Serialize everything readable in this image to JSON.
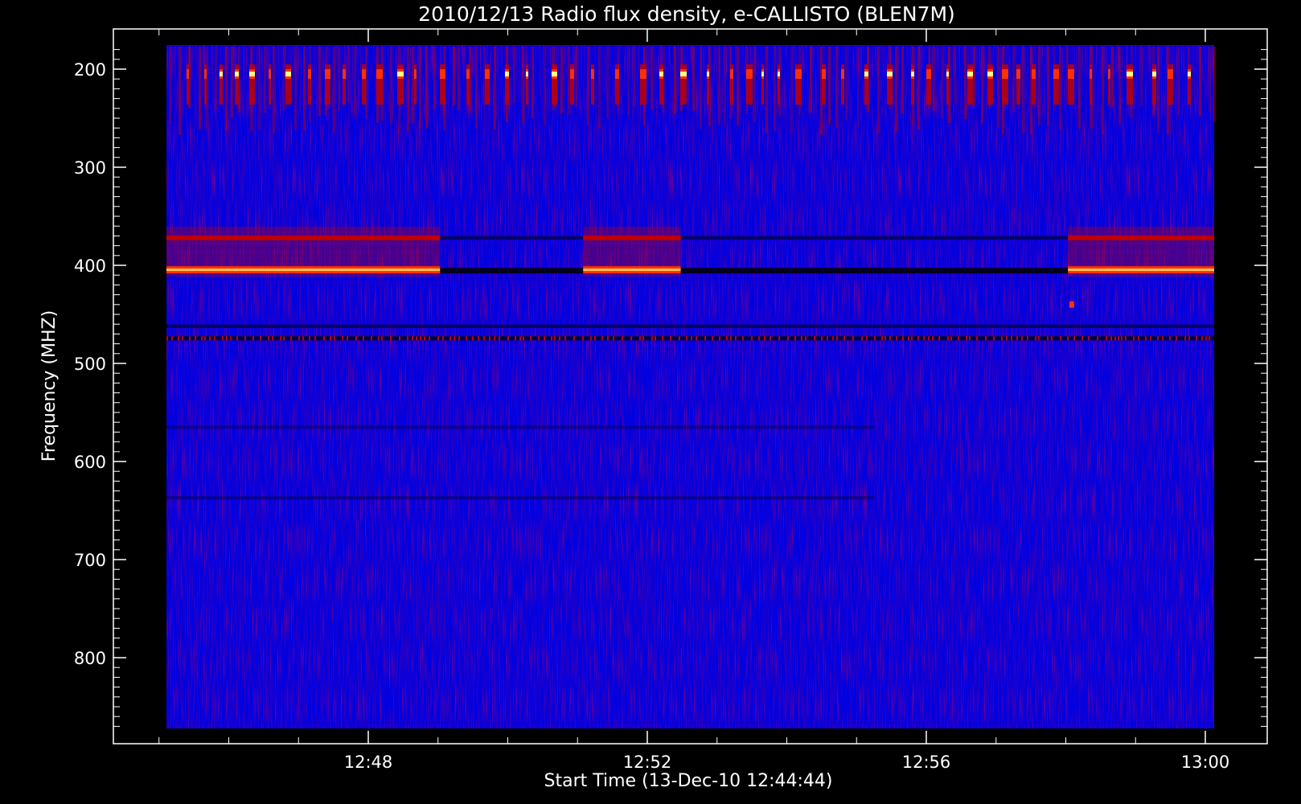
{
  "chart_data": {
    "type": "heatmap",
    "title": "2010/12/13  Radio flux density, e-CALLISTO (BLEN7M)",
    "xlabel": "Start Time (13-Dec-10 12:44:44)",
    "ylabel": "Frequency (MHZ)",
    "x_axis": {
      "unit": "time",
      "range": [
        "12:44:44",
        "13:00:10"
      ],
      "tick_labels": [
        "12:48",
        "12:52",
        "12:56",
        "13:00"
      ],
      "tick_values_min": [
        3.27,
        7.27,
        11.27,
        15.27
      ]
    },
    "y_axis": {
      "unit": "MHz",
      "inverted": true,
      "range": [
        175,
        870
      ],
      "tick_values": [
        200,
        300,
        400,
        500,
        600,
        700,
        800
      ]
    },
    "colors": {
      "background": "#0000e0",
      "low": "#000060",
      "mid": "#c00000",
      "high": "#ff3000",
      "peak": "#ffff80"
    },
    "features": [
      {
        "name": "persistent spikes",
        "freq_mhz": [
          205,
          228
        ]
      },
      {
        "name": "carrier band",
        "freq_mhz": 372
      },
      {
        "name": "carrier band",
        "freq_mhz": 405
      },
      {
        "name": "interference line",
        "freq_mhz": 462
      },
      {
        "name": "interference line",
        "freq_mhz": 474
      }
    ]
  }
}
